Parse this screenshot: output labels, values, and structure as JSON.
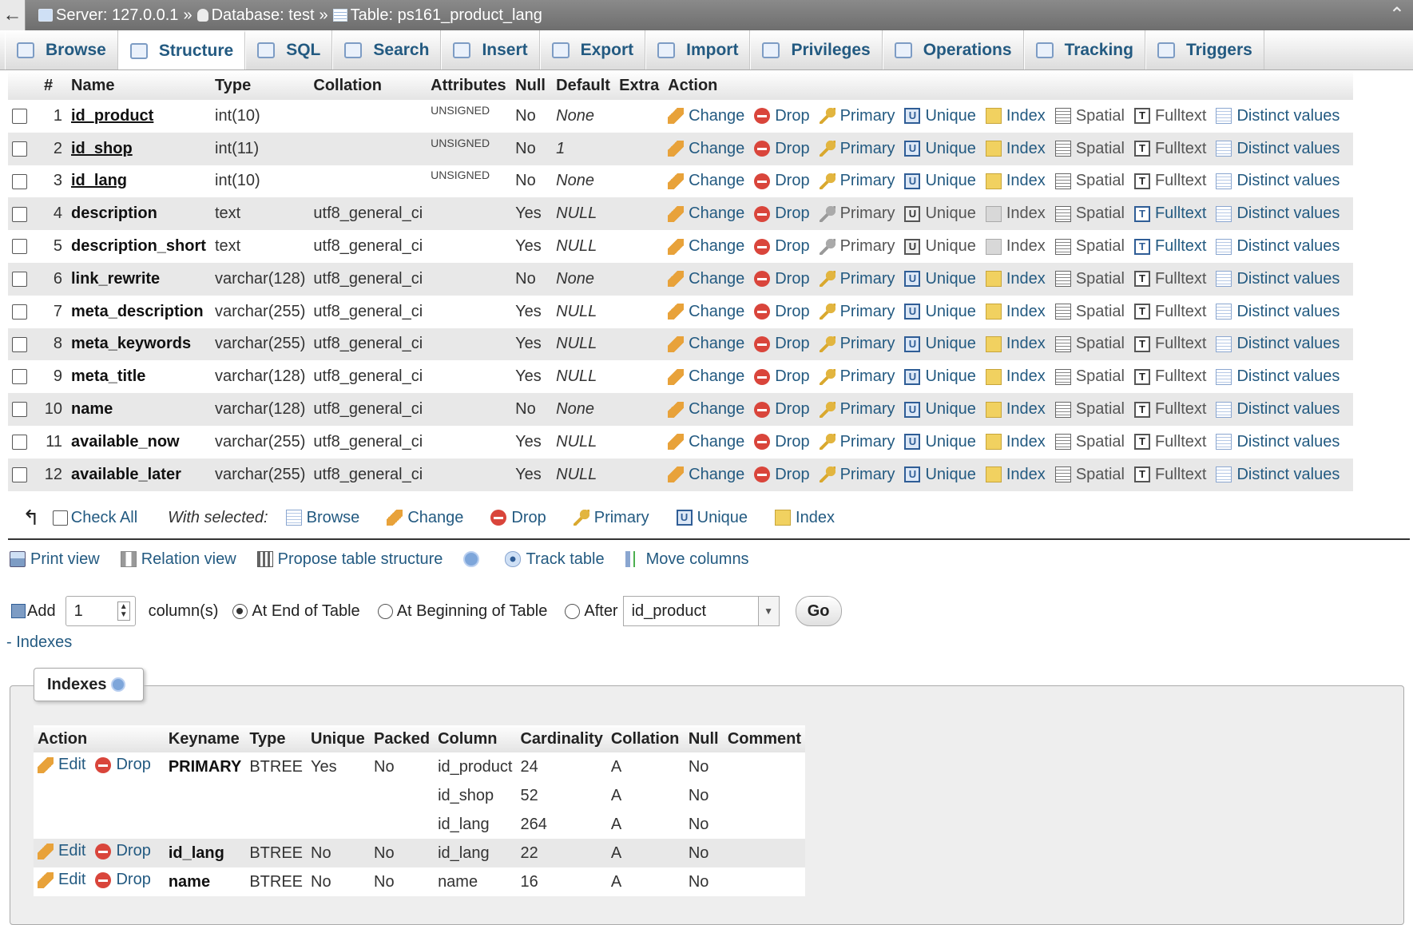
{
  "breadcrumb": {
    "server": "Server: 127.0.0.1",
    "database": "Database: test",
    "table": "Table: ps161_product_lang"
  },
  "tabs": [
    "Browse",
    "Structure",
    "SQL",
    "Search",
    "Insert",
    "Export",
    "Import",
    "Privileges",
    "Operations",
    "Tracking",
    "Triggers"
  ],
  "active_tab": "Structure",
  "structure": {
    "columns": [
      "#",
      "Name",
      "Type",
      "Collation",
      "Attributes",
      "Null",
      "Default",
      "Extra",
      "Action"
    ],
    "rows": [
      {
        "num": "1",
        "name": "id_product",
        "type": "int(10)",
        "collation": "",
        "attributes": "UNSIGNED",
        "null": "No",
        "default": "None",
        "extra": ""
      },
      {
        "num": "2",
        "name": "id_shop",
        "type": "int(11)",
        "collation": "",
        "attributes": "UNSIGNED",
        "null": "No",
        "default": "1",
        "extra": ""
      },
      {
        "num": "3",
        "name": "id_lang",
        "type": "int(10)",
        "collation": "",
        "attributes": "UNSIGNED",
        "null": "No",
        "default": "None",
        "extra": ""
      },
      {
        "num": "4",
        "name": "description",
        "type": "text",
        "collation": "utf8_general_ci",
        "attributes": "",
        "null": "Yes",
        "default": "NULL",
        "extra": ""
      },
      {
        "num": "5",
        "name": "description_short",
        "type": "text",
        "collation": "utf8_general_ci",
        "attributes": "",
        "null": "Yes",
        "default": "NULL",
        "extra": ""
      },
      {
        "num": "6",
        "name": "link_rewrite",
        "type": "varchar(128)",
        "collation": "utf8_general_ci",
        "attributes": "",
        "null": "No",
        "default": "None",
        "extra": ""
      },
      {
        "num": "7",
        "name": "meta_description",
        "type": "varchar(255)",
        "collation": "utf8_general_ci",
        "attributes": "",
        "null": "Yes",
        "default": "NULL",
        "extra": ""
      },
      {
        "num": "8",
        "name": "meta_keywords",
        "type": "varchar(255)",
        "collation": "utf8_general_ci",
        "attributes": "",
        "null": "Yes",
        "default": "NULL",
        "extra": ""
      },
      {
        "num": "9",
        "name": "meta_title",
        "type": "varchar(128)",
        "collation": "utf8_general_ci",
        "attributes": "",
        "null": "Yes",
        "default": "NULL",
        "extra": ""
      },
      {
        "num": "10",
        "name": "name",
        "type": "varchar(128)",
        "collation": "utf8_general_ci",
        "attributes": "",
        "null": "No",
        "default": "None",
        "extra": ""
      },
      {
        "num": "11",
        "name": "available_now",
        "type": "varchar(255)",
        "collation": "utf8_general_ci",
        "attributes": "",
        "null": "Yes",
        "default": "NULL",
        "extra": ""
      },
      {
        "num": "12",
        "name": "available_later",
        "type": "varchar(255)",
        "collation": "utf8_general_ci",
        "attributes": "",
        "null": "Yes",
        "default": "NULL",
        "extra": ""
      }
    ],
    "action_labels": [
      "Change",
      "Drop",
      "Primary",
      "Unique",
      "Index",
      "Spatial",
      "Fulltext",
      "Distinct values"
    ]
  },
  "with_selected": {
    "check_all": "Check All",
    "label": "With selected:",
    "actions": [
      "Browse",
      "Change",
      "Drop",
      "Primary",
      "Unique",
      "Index"
    ]
  },
  "links": {
    "print_view": "Print view",
    "relation_view": "Relation view",
    "propose": "Propose table structure",
    "track": "Track table",
    "move": "Move columns"
  },
  "add_columns": {
    "add_label": "Add",
    "count": "1",
    "unit": "column(s)",
    "at_end": "At End of Table",
    "at_beginning": "At Beginning of Table",
    "after": "After",
    "after_value": "id_product",
    "go": "Go"
  },
  "indexes_toggle": "- Indexes",
  "indexes": {
    "legend": "Indexes",
    "columns": [
      "Action",
      "Keyname",
      "Type",
      "Unique",
      "Packed",
      "Column",
      "Cardinality",
      "Collation",
      "Null",
      "Comment"
    ],
    "edit_label": "Edit",
    "drop_label": "Drop",
    "groups": [
      {
        "keyname": "PRIMARY",
        "type": "BTREE",
        "unique": "Yes",
        "packed": "No",
        "comment": "",
        "cols": [
          {
            "column": "id_product",
            "cardinality": "24",
            "collation": "A",
            "null": "No"
          },
          {
            "column": "id_shop",
            "cardinality": "52",
            "collation": "A",
            "null": "No"
          },
          {
            "column": "id_lang",
            "cardinality": "264",
            "collation": "A",
            "null": "No"
          }
        ]
      },
      {
        "keyname": "id_lang",
        "type": "BTREE",
        "unique": "No",
        "packed": "No",
        "comment": "",
        "cols": [
          {
            "column": "id_lang",
            "cardinality": "22",
            "collation": "A",
            "null": "No"
          }
        ]
      },
      {
        "keyname": "name",
        "type": "BTREE",
        "unique": "No",
        "packed": "No",
        "comment": "",
        "cols": [
          {
            "column": "name",
            "cardinality": "16",
            "collation": "A",
            "null": "No"
          }
        ]
      }
    ]
  }
}
